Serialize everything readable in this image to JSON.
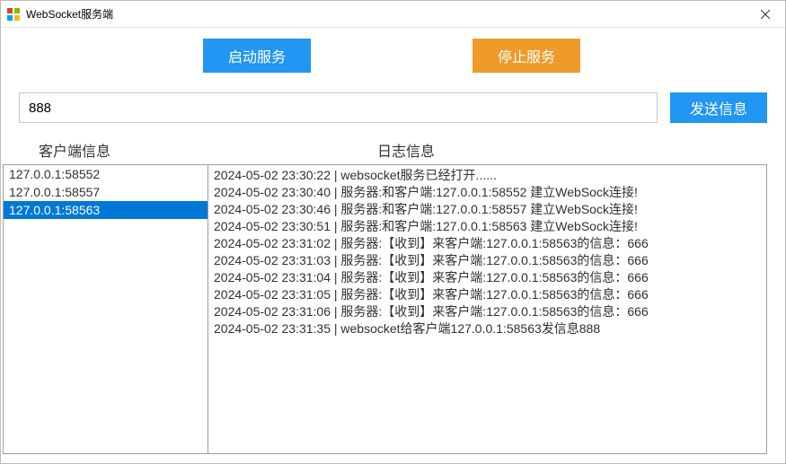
{
  "window": {
    "title": "WebSocket服务端"
  },
  "buttons": {
    "start": "启动服务",
    "stop": "停止服务",
    "send": "发送信息"
  },
  "input": {
    "value": "888"
  },
  "headers": {
    "clients": "客户端信息",
    "logs": "日志信息"
  },
  "clients": [
    {
      "addr": "127.0.0.1:58552",
      "selected": false
    },
    {
      "addr": "127.0.0.1:58557",
      "selected": false
    },
    {
      "addr": "127.0.0.1:58563",
      "selected": true
    }
  ],
  "logs": [
    "2024-05-02 23:30:22  |  websocket服务已经打开......",
    "2024-05-02 23:30:40  |  服务器:和客户端:127.0.0.1:58552 建立WebSock连接!",
    "2024-05-02 23:30:46  |  服务器:和客户端:127.0.0.1:58557 建立WebSock连接!",
    "2024-05-02 23:30:51  |  服务器:和客户端:127.0.0.1:58563 建立WebSock连接!",
    "2024-05-02 23:31:02  |  服务器:【收到】来客户端:127.0.0.1:58563的信息：666",
    "2024-05-02 23:31:03  |  服务器:【收到】来客户端:127.0.0.1:58563的信息：666",
    "2024-05-02 23:31:04  |  服务器:【收到】来客户端:127.0.0.1:58563的信息：666",
    "2024-05-02 23:31:05  |  服务器:【收到】来客户端:127.0.0.1:58563的信息：666",
    "2024-05-02 23:31:06  |  服务器:【收到】来客户端:127.0.0.1:58563的信息：666",
    "2024-05-02 23:31:35  |  websocket给客户端127.0.0.1:58563发信息888"
  ]
}
